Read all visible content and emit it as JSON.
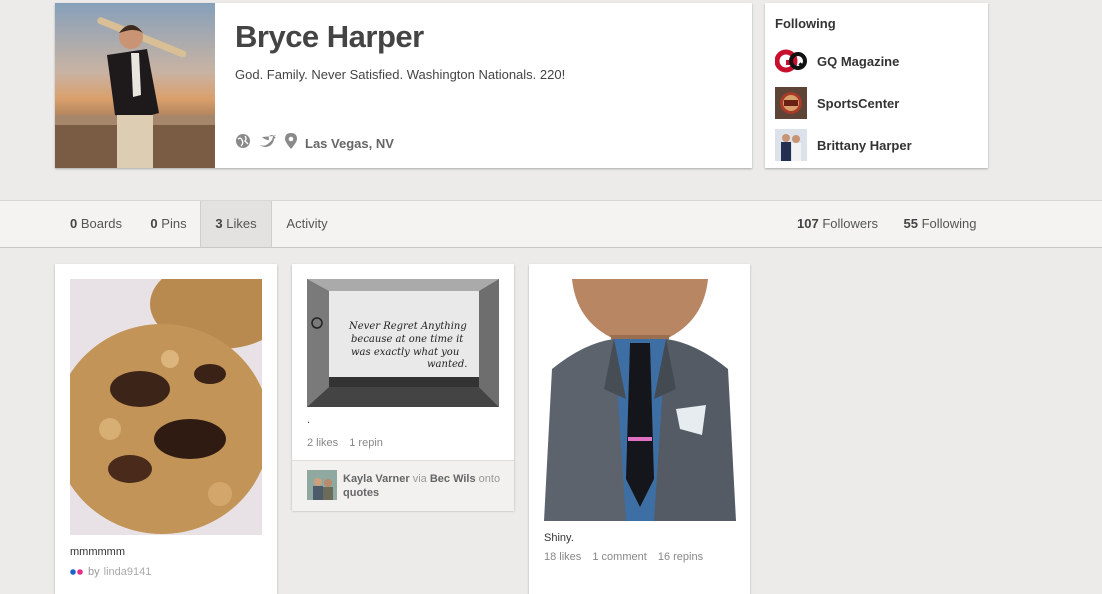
{
  "profile": {
    "name": "Bryce Harper",
    "bio": "God. Family. Never Satisfied. Washington Nationals. 220!",
    "location": "Las Vegas, NV",
    "icons": [
      "globe-icon",
      "twitter-bird-icon",
      "map-pin-icon"
    ]
  },
  "following_panel": {
    "title": "Following",
    "items": [
      {
        "name": "GQ Magazine",
        "icon": "gq-logo"
      },
      {
        "name": "SportsCenter",
        "icon": "sportscenter-logo"
      },
      {
        "name": "Brittany Harper",
        "icon": "user-avatar"
      }
    ]
  },
  "tabs": [
    {
      "count": "0",
      "label": "Boards"
    },
    {
      "count": "0",
      "label": "Pins"
    },
    {
      "count": "3",
      "label": "Likes",
      "active": true
    },
    {
      "count": "",
      "label": "Activity"
    }
  ],
  "stats": {
    "followers_count": "107",
    "followers_label": "Followers",
    "following_count": "55",
    "following_label": "Following"
  },
  "pins": [
    {
      "description": "mmmmmm",
      "by_prefix": "by",
      "by_user": "linda9141"
    },
    {
      "description": ".",
      "likes": "2 likes",
      "repins": "1 repin",
      "image_text": [
        "Never Regret Anything",
        "because at one time it",
        "was exactly what you",
        "wanted."
      ],
      "pinner": "Kayla Varner",
      "via_word": "via",
      "via_user": "Bec Wils",
      "onto_word": "onto",
      "board": "quotes"
    },
    {
      "description": "Shiny.",
      "likes": "18 likes",
      "comments": "1 comment",
      "repins": "16 repins"
    }
  ],
  "colors": {
    "background": "#ecebe9",
    "card": "#ffffff",
    "tab_bar": "#f4f3f2",
    "tab_active": "#e3e2e0",
    "gq_red": "#c8102e"
  }
}
